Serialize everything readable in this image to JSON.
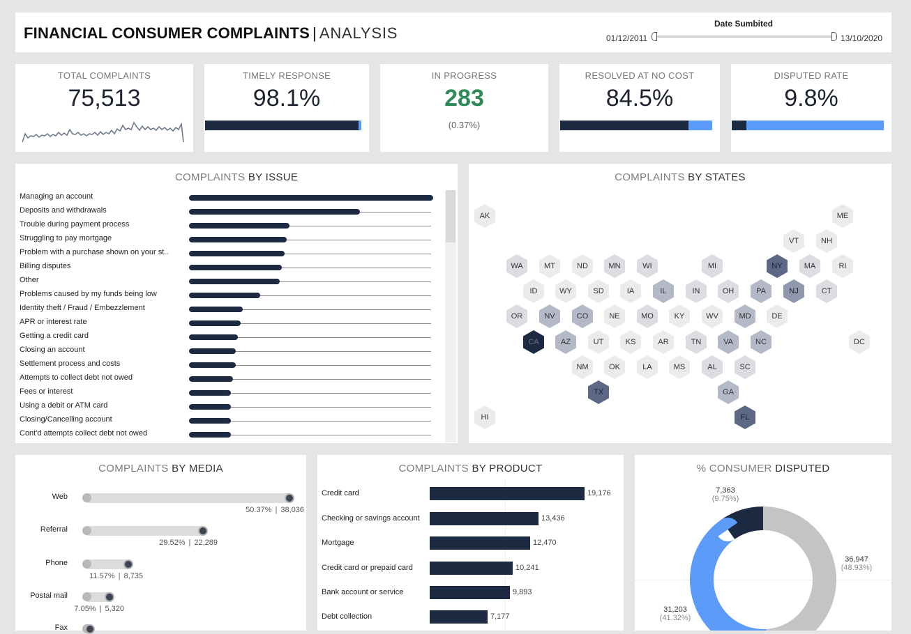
{
  "header": {
    "title_bold": "FINANCIAL CONSUMER COMPLAINTS",
    "separator": "|",
    "title_light": "ANALYSIS",
    "date_filter": {
      "label": "Date Sumbited",
      "start": "01/12/2011",
      "end": "13/10/2020"
    }
  },
  "kpis": {
    "total": {
      "label": "TOTAL COMPLAINTS",
      "value": "75,513"
    },
    "timely": {
      "label": "TIMELY RESPONSE",
      "value": "98.1%",
      "fraction": 0.981
    },
    "progress": {
      "label": "IN PROGRESS",
      "value": "283",
      "sub": "(0.37%)"
    },
    "resolved": {
      "label": "RESOLVED AT NO COST",
      "value": "84.5%",
      "fraction": 0.845
    },
    "disputed": {
      "label": "DISPUTED RATE",
      "value": "9.8%",
      "fraction": 0.098
    }
  },
  "colors": {
    "navy": "#1c2a42",
    "blue": "#5c9bf8",
    "green": "#2e8b57",
    "gray": "#c4c4c4"
  },
  "issues": {
    "title_light": "COMPLAINTS",
    "title_dark": "BY ISSUE",
    "items": [
      {
        "label": "Managing an account",
        "value": 1.0
      },
      {
        "label": "Deposits and withdrawals",
        "value": 0.7
      },
      {
        "label": "Trouble during payment process",
        "value": 0.41
      },
      {
        "label": "Struggling to pay mortgage",
        "value": 0.4
      },
      {
        "label": "Problem with a purchase shown on your st..",
        "value": 0.39
      },
      {
        "label": "Billing disputes",
        "value": 0.38
      },
      {
        "label": "Other",
        "value": 0.37
      },
      {
        "label": "Problems caused by my funds being low",
        "value": 0.29
      },
      {
        "label": "Identity theft / Fraud / Embezzlement",
        "value": 0.22
      },
      {
        "label": "APR or interest rate",
        "value": 0.21
      },
      {
        "label": "Getting a credit card",
        "value": 0.2
      },
      {
        "label": "Closing an account",
        "value": 0.19
      },
      {
        "label": "Settlement process and costs",
        "value": 0.19
      },
      {
        "label": "Attempts to collect debt not owed",
        "value": 0.18
      },
      {
        "label": "Fees or interest",
        "value": 0.17
      },
      {
        "label": "Using a debit or ATM card",
        "value": 0.17
      },
      {
        "label": "Closing/Cancelling account",
        "value": 0.17
      },
      {
        "label": "Cont'd attempts collect debt not owed",
        "value": 0.17
      }
    ]
  },
  "states": {
    "title_light": "COMPLAINTS",
    "title_dark": "BY STATES",
    "items": [
      {
        "code": "AK",
        "level": 0
      },
      {
        "code": "ME",
        "level": 0
      },
      {
        "code": "VT",
        "level": 0
      },
      {
        "code": "NH",
        "level": 0
      },
      {
        "code": "WA",
        "level": 1
      },
      {
        "code": "MT",
        "level": 0
      },
      {
        "code": "ND",
        "level": 0
      },
      {
        "code": "MN",
        "level": 1
      },
      {
        "code": "WI",
        "level": 1
      },
      {
        "code": "MI",
        "level": 1
      },
      {
        "code": "NY",
        "level": 4
      },
      {
        "code": "MA",
        "level": 1
      },
      {
        "code": "RI",
        "level": 0
      },
      {
        "code": "ID",
        "level": 0
      },
      {
        "code": "WY",
        "level": 0
      },
      {
        "code": "SD",
        "level": 0
      },
      {
        "code": "IA",
        "level": 0
      },
      {
        "code": "IL",
        "level": 2
      },
      {
        "code": "IN",
        "level": 1
      },
      {
        "code": "OH",
        "level": 1
      },
      {
        "code": "PA",
        "level": 2
      },
      {
        "code": "NJ",
        "level": 3
      },
      {
        "code": "CT",
        "level": 1
      },
      {
        "code": "OR",
        "level": 1
      },
      {
        "code": "NV",
        "level": 2
      },
      {
        "code": "CO",
        "level": 2
      },
      {
        "code": "NE",
        "level": 0
      },
      {
        "code": "MO",
        "level": 1
      },
      {
        "code": "KY",
        "level": 0
      },
      {
        "code": "WV",
        "level": 0
      },
      {
        "code": "MD",
        "level": 2
      },
      {
        "code": "DE",
        "level": 0
      },
      {
        "code": "CA",
        "level": 5
      },
      {
        "code": "AZ",
        "level": 2
      },
      {
        "code": "UT",
        "level": 0
      },
      {
        "code": "KS",
        "level": 0
      },
      {
        "code": "AR",
        "level": 0
      },
      {
        "code": "TN",
        "level": 1
      },
      {
        "code": "VA",
        "level": 2
      },
      {
        "code": "NC",
        "level": 2
      },
      {
        "code": "DC",
        "level": 0
      },
      {
        "code": "NM",
        "level": 0
      },
      {
        "code": "OK",
        "level": 0
      },
      {
        "code": "LA",
        "level": 0
      },
      {
        "code": "MS",
        "level": 0
      },
      {
        "code": "AL",
        "level": 1
      },
      {
        "code": "SC",
        "level": 1
      },
      {
        "code": "TX",
        "level": 4
      },
      {
        "code": "GA",
        "level": 2
      },
      {
        "code": "HI",
        "level": 0
      },
      {
        "code": "FL",
        "level": 4
      }
    ]
  },
  "media": {
    "title_light": "COMPLAINTS",
    "title_dark": "BY MEDIA",
    "items": [
      {
        "label": "Web",
        "pct": "50.37%",
        "sep": "|",
        "count": "38,036",
        "fraction": 0.5037
      },
      {
        "label": "Referral",
        "pct": "29.52%",
        "sep": "|",
        "count": "22,289",
        "fraction": 0.2952
      },
      {
        "label": "Phone",
        "pct": "11.57%",
        "sep": "|",
        "count": "8,735",
        "fraction": 0.1157
      },
      {
        "label": "Postal mail",
        "pct": "7.05%",
        "sep": "|",
        "count": "5,320",
        "fraction": 0.0705
      },
      {
        "label": "Fax",
        "fraction": 0.01
      }
    ]
  },
  "products": {
    "title_light": "COMPLAINTS",
    "title_dark": "BY PRODUCT",
    "items": [
      {
        "label": "Credit card",
        "value": 19176,
        "display": "19,176"
      },
      {
        "label": "Checking or savings account",
        "value": 13436,
        "display": "13,436"
      },
      {
        "label": "Mortgage",
        "value": 12470,
        "display": "12,470"
      },
      {
        "label": "Credit card or prepaid card",
        "value": 10241,
        "display": "10,241"
      },
      {
        "label": "Bank account or service",
        "value": 9893,
        "display": "9,893"
      },
      {
        "label": "Debt collection",
        "value": 7177,
        "display": "7,177"
      }
    ]
  },
  "disputed": {
    "title_light": "% CONSUMER",
    "title_dark": "DISPUTED",
    "segments": [
      {
        "count": "7,363",
        "pct": "(9.75%)",
        "fraction": 0.0975,
        "color": "#1c2a42"
      },
      {
        "count": "36,947",
        "pct": "(48.93%)",
        "fraction": 0.4893,
        "color": "#c4c4c4"
      },
      {
        "count": "31,203",
        "pct": "(41.32%)",
        "fraction": 0.4132,
        "color": "#5c9bf8"
      }
    ]
  }
}
